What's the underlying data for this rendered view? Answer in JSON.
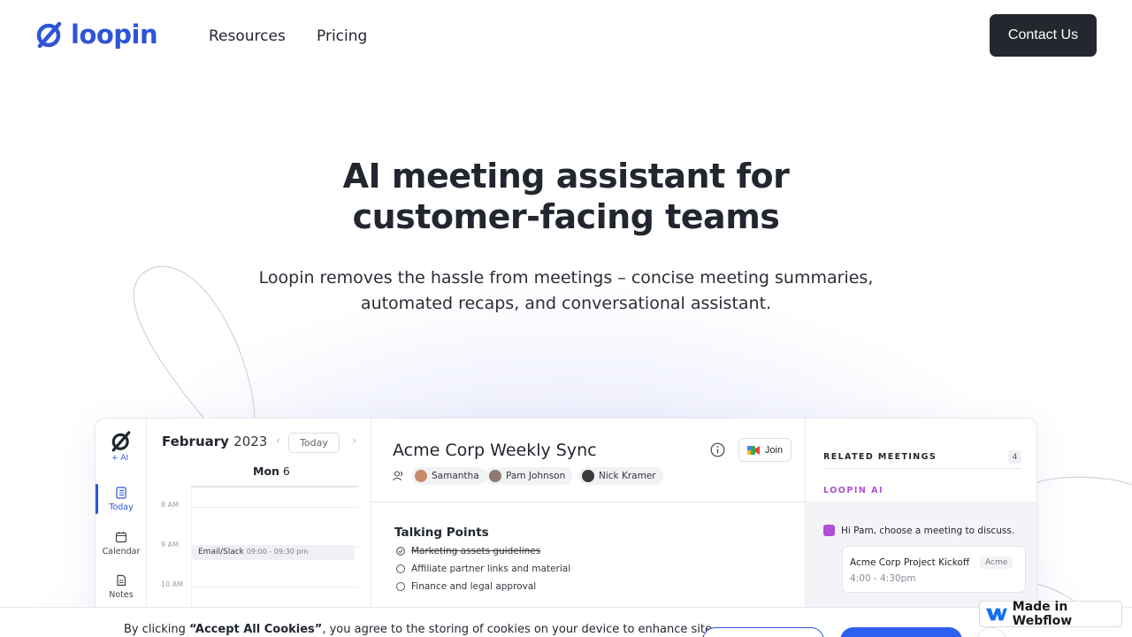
{
  "brand": {
    "name": "loopin",
    "color": "#2d55d6"
  },
  "nav": {
    "links": [
      "Resources",
      "Pricing"
    ],
    "contact_label": "Contact Us"
  },
  "hero": {
    "title_line1": "AI meeting assistant for",
    "title_line2": "customer-facing teams",
    "subtitle_line1": "Loopin removes the hassle from meetings – concise meeting summaries,",
    "subtitle_line2": "automated recaps, and conversational assistant."
  },
  "app": {
    "rail": {
      "ai_label": "+ AI",
      "items": [
        "Today",
        "Calendar",
        "Notes"
      ]
    },
    "calendar": {
      "month": "February",
      "year": "2023",
      "today_button": "Today",
      "day_name": "Mon",
      "day_num": "6",
      "times": [
        "8 AM",
        "9 AM",
        "10 AM"
      ],
      "event": {
        "name": "Email/Slack",
        "time": "09:00 - 09:30 pm"
      }
    },
    "meeting": {
      "title": "Acme Corp Weekly Sync",
      "join_label": "Join",
      "attendees": [
        "Samantha",
        "Pam Johnson",
        "Nick Kramer"
      ],
      "talking_points_title": "Talking Points",
      "talking_points": [
        "Marketing assets guidelines",
        "Affiliate partner links and material",
        "Finance and legal approval"
      ]
    },
    "side": {
      "related_heading": "RELATED MEETINGS",
      "related_count": "4",
      "ai_label": "LOOPIN AI",
      "ai_message": "Hi Pam, choose a meeting to discuss.",
      "card": {
        "name": "Acme Corp Project Kickoff",
        "time": "4:00 - 4:30pm",
        "tag": "Acme"
      }
    }
  },
  "cookie": {
    "text_before": "By clicking ",
    "text_bold": "“Accept All Cookies”",
    "text_after": ", you agree to the storing of cookies on your device to enhance site"
  },
  "webflow_badge": "Made in Webflow",
  "colors": {
    "dark_button": "#24272e",
    "ai_purple": "#b24fd6",
    "cookie_primary": "#2d5ff0"
  }
}
